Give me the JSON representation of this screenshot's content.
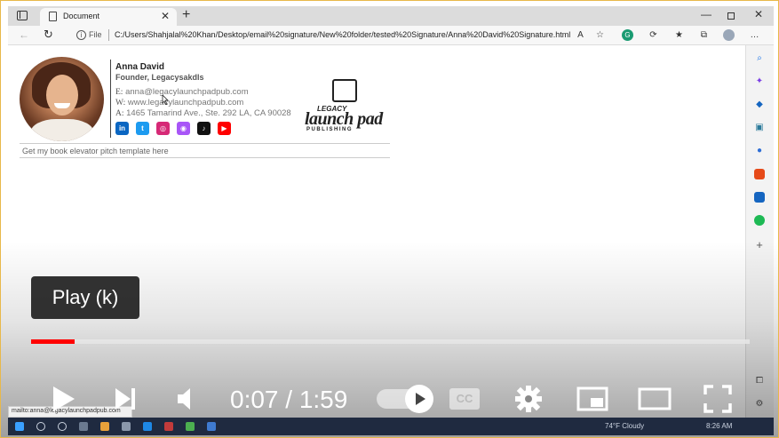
{
  "browser": {
    "tab_title": "Document",
    "file_label": "File",
    "url": "C:/Users/Shahjalal%20Khan/Desktop/email%20signature/New%20folder/tested%20Signature/Anna%20David%20Signature.html"
  },
  "signature": {
    "name": "Anna David",
    "role": "Founder, Legacysakdls",
    "email_label": "E:",
    "email": "anna@legacylaunchpadpub.com",
    "web_label": "W:",
    "web": "www.legacylaunchpadpub.com",
    "address_label": "A:",
    "address": "1465 Tamarind Ave., Ste. 292 LA, CA 90028",
    "socials": [
      {
        "name": "linkedin-icon",
        "glyph": "in",
        "color": "#0a66c2"
      },
      {
        "name": "twitter-icon",
        "glyph": "t",
        "color": "#1d9bf0"
      },
      {
        "name": "instagram-icon",
        "glyph": "◎",
        "color": "#d62976"
      },
      {
        "name": "podcast-icon",
        "glyph": "◉",
        "color": "#a855f7"
      },
      {
        "name": "tiktok-icon",
        "glyph": "♪",
        "color": "#111111"
      },
      {
        "name": "youtube-icon",
        "glyph": "▶",
        "color": "#ff0000"
      }
    ],
    "link_text": "Get my book elevator pitch template here",
    "logo": {
      "top": "LEGACY",
      "main": "launch pad",
      "sub": "PUBLISHING"
    }
  },
  "player": {
    "tooltip": "Play (k)",
    "time": "0:07 / 1:59",
    "progress_fraction": 0.06,
    "cc_label": "CC",
    "accent_color": "#ff0000"
  },
  "status_url": "mailto:anna@legacylaunchpadpub.com",
  "taskbar": {
    "weather": "74°F  Cloudy",
    "time": "8:26 AM"
  }
}
